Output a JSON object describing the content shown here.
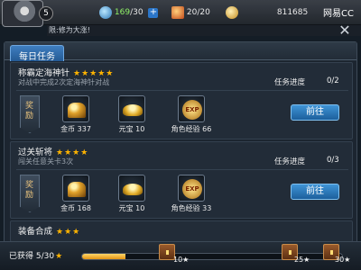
{
  "header": {
    "level": "5",
    "energy": "169",
    "energy_max": "/30",
    "stamina": "20/20",
    "coins": "811685",
    "brand": "网易CC",
    "ticker": "限:修为大涨!"
  },
  "panel": {
    "tab_label": "每日任务",
    "close_symbol": "✕",
    "reward_label": "奖励",
    "progress_label": "任务进度"
  },
  "tasks": [
    {
      "title": "称霸定海神针",
      "stars": "★★★★★",
      "desc": "对战中完成2次定海神针对战",
      "progress": "0/2",
      "rewards": [
        {
          "icon": "gold-coins-icon",
          "label": "金币 337"
        },
        {
          "icon": "yuanbao-ingot-icon",
          "label": "元宝 10"
        },
        {
          "icon": "exp-badge-icon",
          "label": "角色经验 66",
          "badge": "EXP"
        }
      ],
      "button": "前往"
    },
    {
      "title": "过关斩将",
      "stars": "★★★★",
      "desc": "闯关任意关卡3次",
      "progress": "0/3",
      "rewards": [
        {
          "icon": "gold-coins-icon",
          "label": "金币 168"
        },
        {
          "icon": "yuanbao-ingot-icon",
          "label": "元宝 10"
        },
        {
          "icon": "exp-badge-icon",
          "label": "角色经验 33",
          "badge": "EXP"
        }
      ],
      "button": "前往"
    },
    {
      "title": "装备合成",
      "stars": "★★★",
      "desc": "",
      "progress": "",
      "rewards": [],
      "button": ""
    }
  ],
  "bottom": {
    "obtained_label": "已获得",
    "obtained_value": "5/30",
    "star": "★",
    "progress_fraction": 0.1667,
    "chests": [
      {
        "label": "10★"
      },
      {
        "label": "25★"
      },
      {
        "label": "30★"
      }
    ]
  }
}
